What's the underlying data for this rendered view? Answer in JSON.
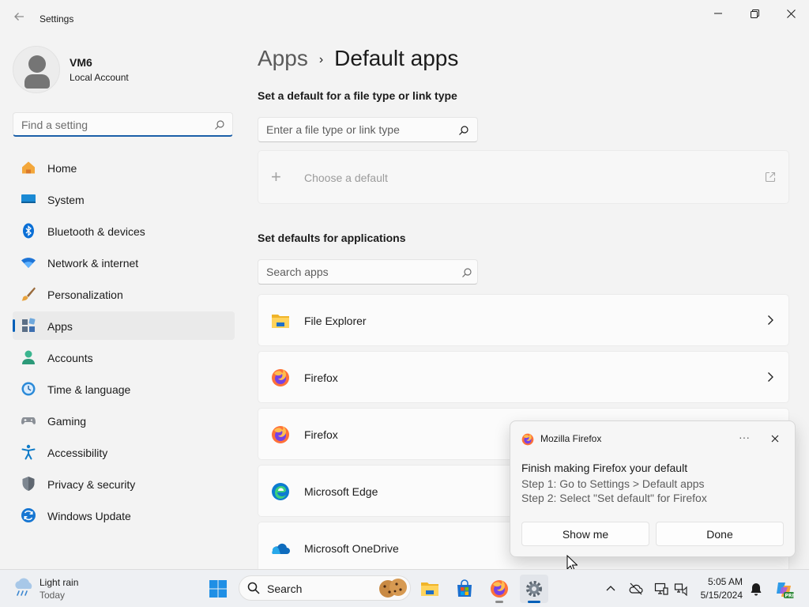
{
  "window": {
    "title": "Settings",
    "back_icon": "back-arrow-icon",
    "controls": [
      "minimize-icon",
      "restore-icon",
      "close-icon"
    ]
  },
  "profile": {
    "name": "VM6",
    "account_type": "Local Account"
  },
  "sidebar": {
    "search_placeholder": "Find a setting",
    "items": [
      {
        "label": "Home",
        "icon": "home-icon"
      },
      {
        "label": "System",
        "icon": "system-icon"
      },
      {
        "label": "Bluetooth & devices",
        "icon": "bluetooth-icon"
      },
      {
        "label": "Network & internet",
        "icon": "wifi-icon"
      },
      {
        "label": "Personalization",
        "icon": "brush-icon"
      },
      {
        "label": "Apps",
        "icon": "apps-icon",
        "active": true
      },
      {
        "label": "Accounts",
        "icon": "accounts-icon"
      },
      {
        "label": "Time & language",
        "icon": "time-language-icon"
      },
      {
        "label": "Gaming",
        "icon": "gaming-icon"
      },
      {
        "label": "Accessibility",
        "icon": "accessibility-icon"
      },
      {
        "label": "Privacy & security",
        "icon": "shield-icon"
      },
      {
        "label": "Windows Update",
        "icon": "windows-update-icon"
      }
    ]
  },
  "main": {
    "breadcrumb": {
      "parent": "Apps",
      "separator": "›",
      "current": "Default apps"
    },
    "file_type_section": {
      "title": "Set a default for a file type or link type",
      "input_placeholder": "Enter a file type or link type",
      "choose_default_label": "Choose a default"
    },
    "apps_section": {
      "title": "Set defaults for applications",
      "search_placeholder": "Search apps",
      "apps": [
        {
          "name": "File Explorer",
          "icon": "file-explorer-icon"
        },
        {
          "name": "Firefox",
          "icon": "firefox-icon"
        },
        {
          "name": "Firefox",
          "icon": "firefox-icon"
        },
        {
          "name": "Microsoft Edge",
          "icon": "edge-icon"
        },
        {
          "name": "Microsoft OneDrive",
          "icon": "onedrive-icon"
        }
      ]
    }
  },
  "notification": {
    "app_name": "Mozilla Firefox",
    "more_label": "···",
    "title": "Finish making Firefox your default",
    "step1": "Step 1: Go to Settings > Default apps",
    "step2": "Step 2: Select \"Set default\" for Firefox",
    "primary_button": "Show me",
    "secondary_button": "Done"
  },
  "taskbar": {
    "weather": {
      "condition": "Light rain",
      "day": "Today",
      "icon": "rain-cloud-icon"
    },
    "search_label": "Search",
    "pinned": [
      "start-icon",
      "file-explorer-icon",
      "store-icon",
      "firefox-icon",
      "settings-icon"
    ],
    "tray_icons": [
      "chevron-up-icon",
      "onedrive-offline-icon",
      "display-icon",
      "network-volume-icon",
      "notification-bell-icon",
      "copilot-icon"
    ],
    "clock": {
      "time": "5:05 AM",
      "date": "5/15/2024"
    }
  },
  "colors": {
    "accent": "#005fb8",
    "background": "#f3f3f3",
    "card": "#fbfbfb",
    "firefox_orange": "#ff7139"
  }
}
